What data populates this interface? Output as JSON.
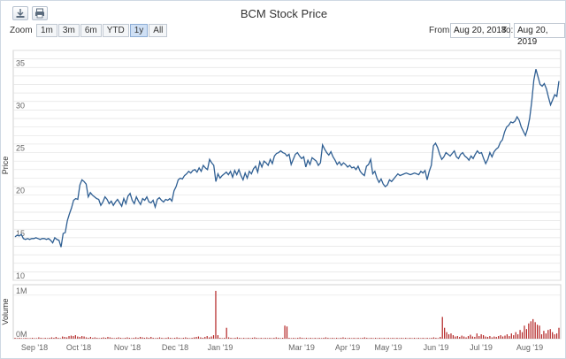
{
  "toolbar": {
    "download_icon": "download-icon",
    "print_icon": "print-icon"
  },
  "title": "BCM Stock Price",
  "zoom": {
    "label": "Zoom",
    "buttons": [
      "1m",
      "3m",
      "6m",
      "YTD",
      "1y",
      "All"
    ],
    "active": "1y"
  },
  "range": {
    "from_label": "From:",
    "from_value": "Aug 20, 2018",
    "to_label": "To:",
    "to_value": "Aug 20, 2019"
  },
  "colors": {
    "price_line": "#2f5f93",
    "volume_bar": "#b22222",
    "grid": "#e3e3e3"
  },
  "chart_data": [
    {
      "type": "line",
      "ylabel": "Price",
      "ylim": [
        10,
        37
      ],
      "yticks": [
        10,
        15,
        20,
        25,
        30,
        35
      ],
      "xlabels": [
        "Sep '18",
        "Oct '18",
        "Nov '18",
        "Dec '18",
        "Jan '19",
        "Mar '19",
        "Apr '19",
        "May '19",
        "Jun '19",
        "Jul '19",
        "Aug '19"
      ],
      "series": [
        {
          "values": [
            15.1,
            15.3,
            15.2,
            15.4,
            14.9,
            14.8,
            14.9,
            14.8,
            14.9,
            14.9,
            15.0,
            14.9,
            14.8,
            14.9,
            14.9,
            14.8,
            14.9,
            14.7,
            14.4,
            15.0,
            14.8,
            14.7,
            13.9,
            15.5,
            15.6,
            17.0,
            17.8,
            18.5,
            19.4,
            19.6,
            19.5,
            21.2,
            21.8,
            21.6,
            21.3,
            19.8,
            20.3,
            20.0,
            19.8,
            19.6,
            19.5,
            18.8,
            19.2,
            19.8,
            19.5,
            19.0,
            19.3,
            18.8,
            19.2,
            19.5,
            19.1,
            18.7,
            19.6,
            19.0,
            19.9,
            20.2,
            19.4,
            19.0,
            19.8,
            19.3,
            18.9,
            19.6,
            19.4,
            19.8,
            19.2,
            19.1,
            19.4,
            18.6,
            19.5,
            19.7,
            19.4,
            19.2,
            19.5,
            19.4,
            19.6,
            19.3,
            20.5,
            21.0,
            21.8,
            22.0,
            21.9,
            22.3,
            22.5,
            22.8,
            22.6,
            22.9,
            23.0,
            22.7,
            23.2,
            22.8,
            23.5,
            23.2,
            23.0,
            24.2,
            23.8,
            23.5,
            21.6,
            22.5,
            22.0,
            22.3,
            22.5,
            22.7,
            22.4,
            22.8,
            22.1,
            22.9,
            22.4,
            23.0,
            22.3,
            21.8,
            22.6,
            22.0,
            22.8,
            22.5,
            23.1,
            23.4,
            22.7,
            23.9,
            23.3,
            24.0,
            23.8,
            23.5,
            24.2,
            23.7,
            24.6,
            24.9,
            25.0,
            25.2,
            25.0,
            24.9,
            24.6,
            24.8,
            23.6,
            24.2,
            24.8,
            25.0,
            24.6,
            24.3,
            24.5,
            23.3,
            24.1,
            23.6,
            24.4,
            24.2,
            24.0,
            23.5,
            23.8,
            25.9,
            25.4,
            25.0,
            24.7,
            25.1,
            24.5,
            24.1,
            23.6,
            23.9,
            23.5,
            23.8,
            23.6,
            23.3,
            23.5,
            23.2,
            23.3,
            23.0,
            23.4,
            22.8,
            22.5,
            22.3,
            23.4,
            23.6,
            24.2,
            22.5,
            22.8,
            22.0,
            21.5,
            21.9,
            21.3,
            21.0,
            21.2,
            21.8,
            21.6,
            21.9,
            22.2,
            22.5,
            22.3,
            22.4,
            22.5,
            22.6,
            22.5,
            22.4,
            22.5,
            22.6,
            22.5,
            22.4,
            22.8,
            22.6,
            22.9,
            21.8,
            22.8,
            23.5,
            25.8,
            26.1,
            25.6,
            24.8,
            24.2,
            24.5,
            25.0,
            24.8,
            24.6,
            24.9,
            25.2,
            24.5,
            24.3,
            24.8,
            25.0,
            24.6,
            24.4,
            24.1,
            24.6,
            24.3,
            24.8,
            25.2,
            24.9,
            25.0,
            24.3,
            23.7,
            24.2,
            25.0,
            24.5,
            25.1,
            25.4,
            25.6,
            26.2,
            26.5,
            27.4,
            28.0,
            28.2,
            28.6,
            28.5,
            28.7,
            29.2,
            28.8,
            28.0,
            27.5,
            27.0,
            27.8,
            29.0,
            31.0,
            33.5,
            34.8,
            33.9,
            33.0,
            32.8,
            33.1,
            32.5,
            31.5,
            30.6,
            31.2,
            31.8,
            31.6,
            33.4
          ]
        }
      ]
    },
    {
      "type": "bar",
      "ylabel": "Volume",
      "yticks_labels": [
        "0M",
        "1M"
      ],
      "ylim": [
        0,
        1.2
      ],
      "values": [
        0.02,
        0.01,
        0.02,
        0.01,
        0.01,
        0.02,
        0.01,
        0.01,
        0.02,
        0.01,
        0.01,
        0.03,
        0.02,
        0.01,
        0.02,
        0.01,
        0.02,
        0.03,
        0.02,
        0.04,
        0.02,
        0.01,
        0.05,
        0.04,
        0.03,
        0.06,
        0.07,
        0.06,
        0.08,
        0.05,
        0.04,
        0.06,
        0.05,
        0.03,
        0.02,
        0.04,
        0.02,
        0.03,
        0.02,
        0.01,
        0.02,
        0.03,
        0.02,
        0.04,
        0.03,
        0.02,
        0.01,
        0.02,
        0.03,
        0.02,
        0.01,
        0.02,
        0.03,
        0.02,
        0.01,
        0.02,
        0.03,
        0.02,
        0.04,
        0.03,
        0.02,
        0.03,
        0.02,
        0.04,
        0.02,
        0.01,
        0.02,
        0.03,
        0.02,
        0.01,
        0.02,
        0.03,
        0.02,
        0.01,
        0.02,
        0.03,
        0.02,
        0.01,
        0.02,
        0.03,
        0.02,
        0.01,
        0.02,
        0.03,
        0.04,
        0.05,
        0.03,
        0.02,
        0.04,
        0.06,
        0.03,
        0.05,
        0.08,
        1.1,
        0.08,
        0.02,
        0.01,
        0.02,
        0.25,
        0.03,
        0.02,
        0.01,
        0.02,
        0.03,
        0.02,
        0.01,
        0.02,
        0.01,
        0.02,
        0.01,
        0.02,
        0.03,
        0.02,
        0.01,
        0.02,
        0.01,
        0.02,
        0.01,
        0.02,
        0.01,
        0.02,
        0.03,
        0.02,
        0.01,
        0.02,
        0.3,
        0.28,
        0.02,
        0.01,
        0.02,
        0.01,
        0.02,
        0.03,
        0.02,
        0.01,
        0.02,
        0.01,
        0.02,
        0.01,
        0.02,
        0.01,
        0.02,
        0.01,
        0.02,
        0.03,
        0.02,
        0.01,
        0.02,
        0.01,
        0.02,
        0.01,
        0.02,
        0.03,
        0.02,
        0.01,
        0.02,
        0.01,
        0.02,
        0.01,
        0.02,
        0.01,
        0.02,
        0.03,
        0.02,
        0.01,
        0.02,
        0.01,
        0.02,
        0.01,
        0.02,
        0.01,
        0.02,
        0.01,
        0.02,
        0.01,
        0.02,
        0.01,
        0.02,
        0.01,
        0.02,
        0.01,
        0.02,
        0.01,
        0.02,
        0.01,
        0.02,
        0.01,
        0.02,
        0.01,
        0.02,
        0.01,
        0.02,
        0.01,
        0.02,
        0.03,
        0.02,
        0.01,
        0.04,
        0.5,
        0.25,
        0.15,
        0.1,
        0.12,
        0.08,
        0.05,
        0.06,
        0.04,
        0.07,
        0.05,
        0.03,
        0.06,
        0.09,
        0.05,
        0.04,
        0.12,
        0.06,
        0.1,
        0.08,
        0.05,
        0.04,
        0.06,
        0.03,
        0.05,
        0.04,
        0.06,
        0.08,
        0.05,
        0.07,
        0.1,
        0.06,
        0.12,
        0.08,
        0.15,
        0.1,
        0.2,
        0.15,
        0.3,
        0.22,
        0.35,
        0.4,
        0.45,
        0.38,
        0.32,
        0.3,
        0.1,
        0.18,
        0.12,
        0.2,
        0.22,
        0.15,
        0.1,
        0.12,
        0.25
      ]
    }
  ]
}
